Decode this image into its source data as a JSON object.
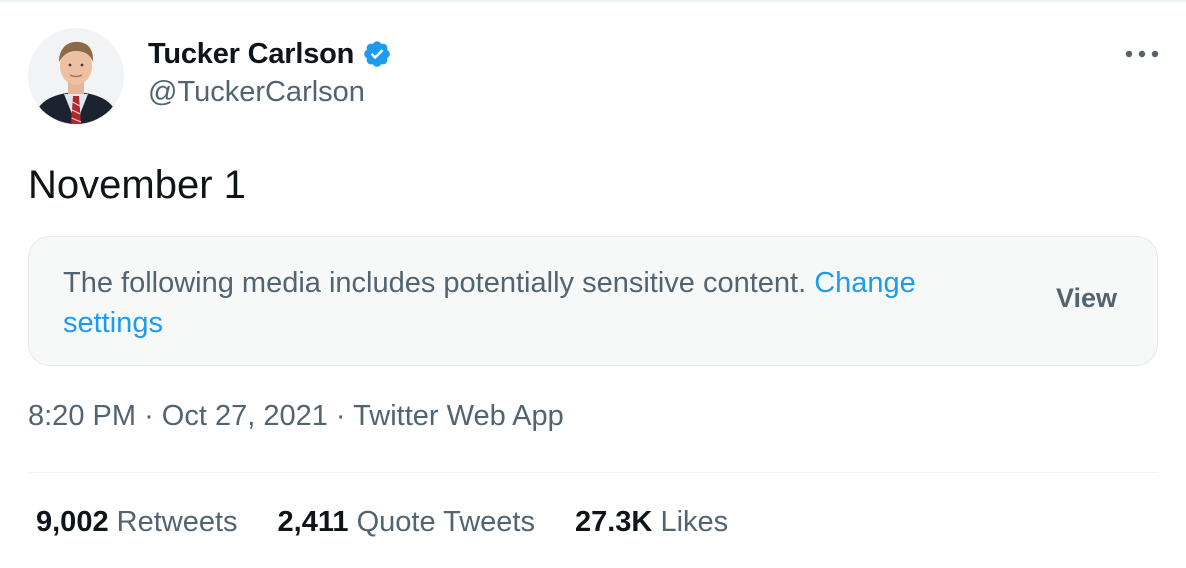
{
  "author": {
    "display_name": "Tucker Carlson",
    "handle": "@TuckerCarlson",
    "verified": true,
    "avatar_icon": "profile-photo"
  },
  "more_icon": "more-options-icon",
  "tweet": {
    "text": "November 1"
  },
  "sensitive_media": {
    "warning": "The following media includes potentially sensitive content.",
    "link_label": "Change settings",
    "view_label": "View"
  },
  "meta": {
    "time": "8:20 PM",
    "separator": "·",
    "date": "Oct 27, 2021",
    "source": "Twitter Web App"
  },
  "stats": {
    "retweets_count": "9,002",
    "retweets_label": "Retweets",
    "quotes_count": "2,411",
    "quotes_label": "Quote Tweets",
    "likes_count": "27.3K",
    "likes_label": "Likes"
  },
  "colors": {
    "accent": "#1d9bf0",
    "secondary_text": "#536471",
    "primary_text": "#0f1419",
    "box_background": "#f7f9f9"
  }
}
